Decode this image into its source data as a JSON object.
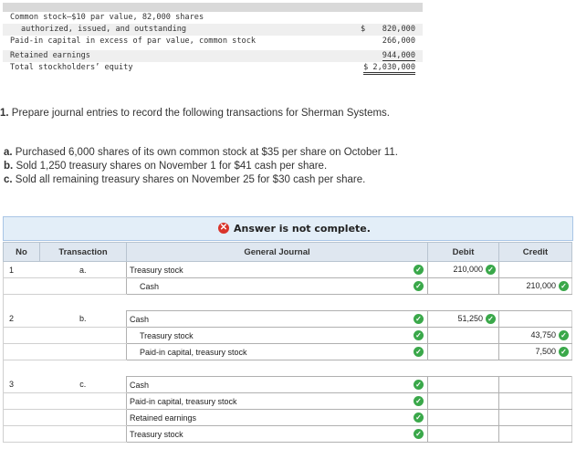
{
  "equity": {
    "rows": [
      {
        "label": "Common stock–$10 par value, 82,000 shares",
        "dollar": "",
        "amount": "",
        "indent": false,
        "shade": false,
        "ul": ""
      },
      {
        "label": "authorized, issued, and outstanding",
        "dollar": "$",
        "amount": "820,000",
        "indent": true,
        "shade": true,
        "ul": ""
      },
      {
        "label": "Paid-in capital in excess of par value, common stock",
        "dollar": "",
        "amount": "266,000",
        "indent": false,
        "shade": false,
        "ul": ""
      },
      {
        "label": "Retained earnings",
        "dollar": "",
        "amount": "944,000",
        "indent": false,
        "shade": true,
        "ul": "ul"
      },
      {
        "label": "Total stockholders’ equity",
        "dollar": "",
        "amount": "$ 2,030,000",
        "indent": false,
        "shade": false,
        "ul": "dul"
      }
    ]
  },
  "question": {
    "title_num": "1.",
    "title": "Prepare journal entries to record the following transactions for Sherman Systems.",
    "items": [
      {
        "letter": "a.",
        "text": "Purchased 6,000 shares of its own common stock at $35 per share on October 11."
      },
      {
        "letter": "b.",
        "text": "Sold 1,250 treasury shares on November 1 for $41 cash per share."
      },
      {
        "letter": "c.",
        "text": "Sold all remaining treasury shares on November 25 for $30 cash per share."
      }
    ]
  },
  "banner": {
    "icon": "x-circle-icon",
    "text": "Answer is not complete."
  },
  "journal": {
    "headers": {
      "no": "No",
      "transaction": "Transaction",
      "general_journal": "General Journal",
      "debit": "Debit",
      "credit": "Credit"
    },
    "rows": [
      {
        "no": "1",
        "trans": "a.",
        "account": "Treasury stock",
        "indent": false,
        "acct_check": true,
        "debit": "210,000",
        "debit_check": true,
        "credit": "",
        "credit_check": false
      },
      {
        "no": "",
        "trans": "",
        "account": "Cash",
        "indent": true,
        "acct_check": true,
        "debit": "",
        "debit_check": false,
        "credit": "210,000",
        "credit_check": true
      },
      {
        "spacer": true
      },
      {
        "no": "2",
        "trans": "b.",
        "account": "Cash",
        "indent": false,
        "acct_check": true,
        "debit": "51,250",
        "debit_check": true,
        "credit": "",
        "credit_check": false
      },
      {
        "no": "",
        "trans": "",
        "account": "Treasury stock",
        "indent": true,
        "acct_check": true,
        "debit": "",
        "debit_check": false,
        "credit": "43,750",
        "credit_check": true
      },
      {
        "no": "",
        "trans": "",
        "account": "Paid-in capital, treasury stock",
        "indent": true,
        "acct_check": true,
        "debit": "",
        "debit_check": false,
        "credit": "7,500",
        "credit_check": true
      },
      {
        "spacer": true
      },
      {
        "no": "3",
        "trans": "c.",
        "account": "Cash",
        "indent": false,
        "acct_check": true,
        "debit": "",
        "debit_check": false,
        "credit": "",
        "credit_check": false
      },
      {
        "no": "",
        "trans": "",
        "account": "Paid-in capital, treasury stock",
        "indent": false,
        "acct_check": true,
        "debit": "",
        "debit_check": false,
        "credit": "",
        "credit_check": false
      },
      {
        "no": "",
        "trans": "",
        "account": "Retained earnings",
        "indent": false,
        "acct_check": true,
        "debit": "",
        "debit_check": false,
        "credit": "",
        "credit_check": false
      },
      {
        "no": "",
        "trans": "",
        "account": "Treasury stock",
        "indent": false,
        "acct_check": true,
        "debit": "",
        "debit_check": false,
        "credit": "",
        "credit_check": false
      }
    ]
  },
  "colors": {
    "check": "#3aa84a",
    "error": "#d9342b",
    "banner_bg": "#e3eef8"
  }
}
